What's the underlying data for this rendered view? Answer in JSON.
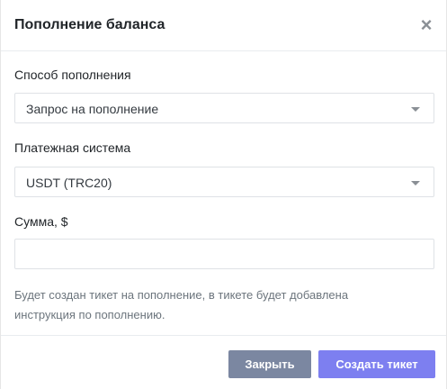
{
  "modal": {
    "title": "Пополнение баланса",
    "close_icon": "×"
  },
  "method": {
    "label": "Способ пополнения",
    "selected": "Запрос на пополнение"
  },
  "payment_system": {
    "label": "Платежная система",
    "selected": "USDT (TRC20)"
  },
  "amount": {
    "label": "Сумма, $",
    "value": "",
    "placeholder": ""
  },
  "help_text": "Будет создан тикет на пополнение, в тикете будет добавлена инструкция по пополнению.",
  "footer": {
    "close_label": "Закрыть",
    "create_label": "Создать тикет"
  },
  "colors": {
    "close_button": "#7b87a1",
    "create_button": "#7d7ff0"
  }
}
